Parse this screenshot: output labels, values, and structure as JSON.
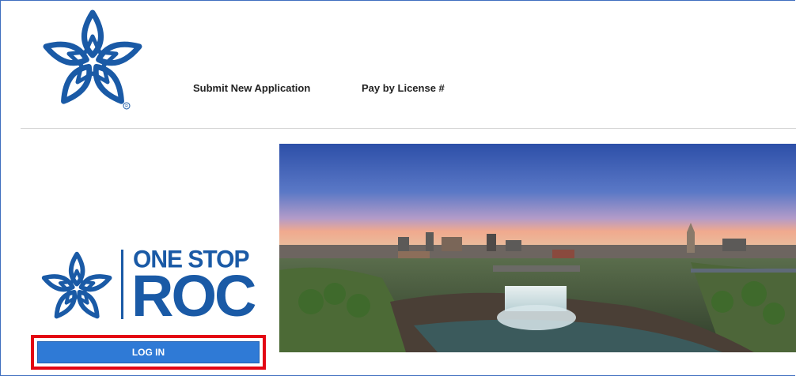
{
  "header": {
    "logo_icon": "city-star-logo-icon",
    "nav": [
      {
        "label": "Submit New Application"
      },
      {
        "label": "Pay by License #"
      }
    ]
  },
  "brand": {
    "icon": "city-star-logo-icon",
    "line1": "ONE STOP",
    "line2": "ROC"
  },
  "login": {
    "label": "LOG IN"
  },
  "hero": {
    "icon": "city-skyline-waterfall-photo"
  },
  "colors": {
    "brand_blue": "#1a5aa6",
    "button_blue": "#2f7ad6",
    "highlight_red": "#e30613",
    "frame_blue": "#3f6fbf"
  }
}
